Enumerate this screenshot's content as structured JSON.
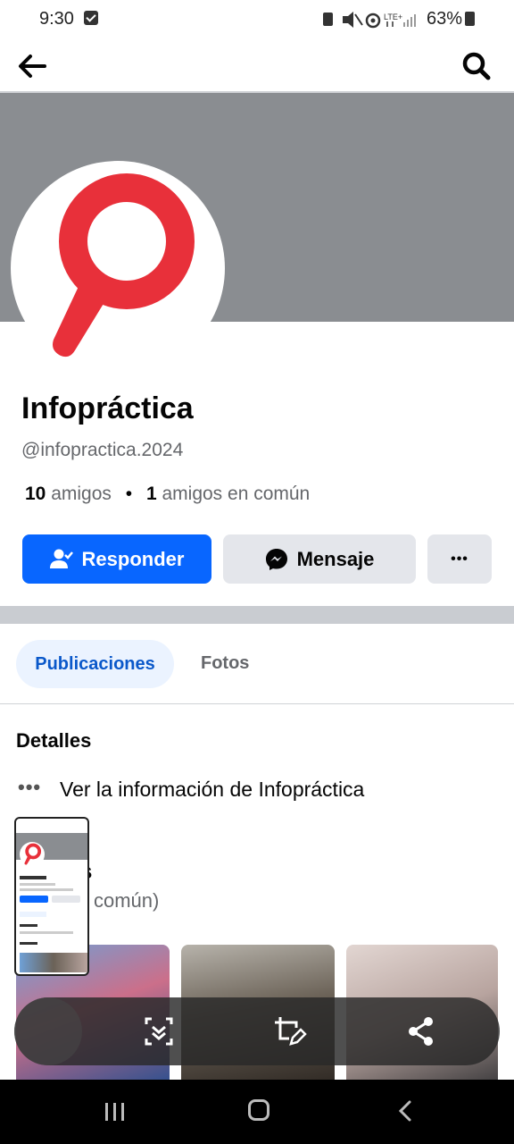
{
  "status_bar": {
    "time": "9:30",
    "battery": "63%",
    "icons": [
      "screenshot-icon",
      "mute-icon",
      "hotspot-icon",
      "lte-icon",
      "signal-icon",
      "battery-icon"
    ]
  },
  "profile": {
    "name": "Infopráctica",
    "handle": "@infopractica.2024",
    "friends_count": "10",
    "friends_label": "amigos",
    "separator": "•",
    "mutual_count": "1",
    "mutual_label": "amigos en común"
  },
  "actions": {
    "respond": "Responder",
    "message": "Mensaje",
    "more": "•••"
  },
  "tabs": [
    {
      "label": "Publicaciones",
      "active": true
    },
    {
      "label": "Fotos",
      "active": false
    }
  ],
  "details": {
    "title": "Detalles",
    "info_dots": "•••",
    "info_text": "Ver la información de Infopráctica"
  },
  "friends_section": {
    "title_visible": "s",
    "subtitle_visible": "común)"
  },
  "colors": {
    "accent": "#0866ff",
    "logo_red": "#e8303a",
    "cover": "#8a8d91"
  }
}
